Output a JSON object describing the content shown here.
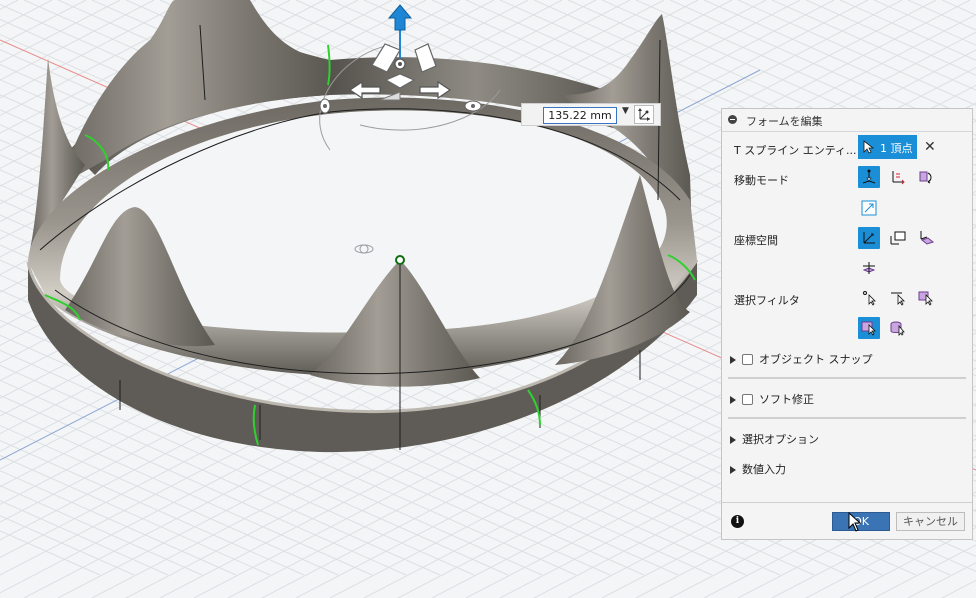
{
  "viewport": {
    "dimension_value": "135.22 mm",
    "dimension_dropdown_icon": "dropdown-arrow-icon",
    "triad_icon": "triad-icon"
  },
  "panel": {
    "title": "フォームを編集",
    "selection_label": "T スプライン エンティ...",
    "selection_button": "1 頂点",
    "move_mode_label": "移動モード",
    "coordinate_space_label": "座標空間",
    "selection_filter_label": "選択フィルタ",
    "object_snap_label": "オブジェクト スナップ",
    "soft_modify_label": "ソフト修正",
    "selection_options_label": "選択オプション",
    "numeric_input_label": "数値入力",
    "ok_label": "OK",
    "cancel_label": "キャンセル"
  },
  "colors": {
    "accent": "#1a8fd8",
    "ok_button": "#3a74b5",
    "edge_highlight": "#2fd02f",
    "axis_red": "#e05050",
    "axis_blue": "#4a7fd0"
  }
}
